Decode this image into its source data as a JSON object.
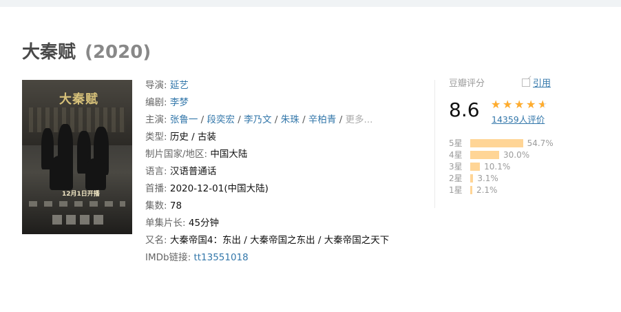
{
  "title": "大秦赋",
  "year": "(2020)",
  "info": {
    "director_label": "导演:",
    "director": "延艺",
    "writer_label": "编剧:",
    "writer": "李梦",
    "cast_label": "主演:",
    "cast": [
      "张鲁一",
      "段奕宏",
      "李乃文",
      "朱珠",
      "辛柏青"
    ],
    "cast_more": "更多...",
    "genre_label": "类型:",
    "genre": "历史 / 古装",
    "country_label": "制片国家/地区:",
    "country": "中国大陆",
    "language_label": "语言:",
    "language": "汉语普通话",
    "premiere_label": "首播:",
    "premiere": "2020-12-01(中国大陆)",
    "episodes_label": "集数:",
    "episodes": "78",
    "runtime_label": "单集片长:",
    "runtime": "45分钟",
    "aka_label": "又名:",
    "aka": "大秦帝国4：东出 / 大秦帝国之东出 / 大秦帝国之天下",
    "imdb_label": "IMDb链接:",
    "imdb": "tt13551018"
  },
  "poster": {
    "title_text": "大秦赋",
    "date_text": "12月1日开播"
  },
  "rating": {
    "header": "豆瓣评分",
    "cite": "引用",
    "score": "8.6",
    "star_value": 4.5,
    "star_max": 5,
    "votes": "14359人评价",
    "distribution": [
      {
        "label": "5星",
        "percent": 54.7,
        "percent_text": "54.7%"
      },
      {
        "label": "4星",
        "percent": 30.0,
        "percent_text": "30.0%"
      },
      {
        "label": "3星",
        "percent": 10.1,
        "percent_text": "10.1%"
      },
      {
        "label": "2星",
        "percent": 3.1,
        "percent_text": "3.1%"
      },
      {
        "label": "1星",
        "percent": 2.1,
        "percent_text": "2.1%"
      }
    ]
  },
  "colors": {
    "link": "#3377aa",
    "star": "#ffac2d",
    "bar": "#ffd596"
  }
}
